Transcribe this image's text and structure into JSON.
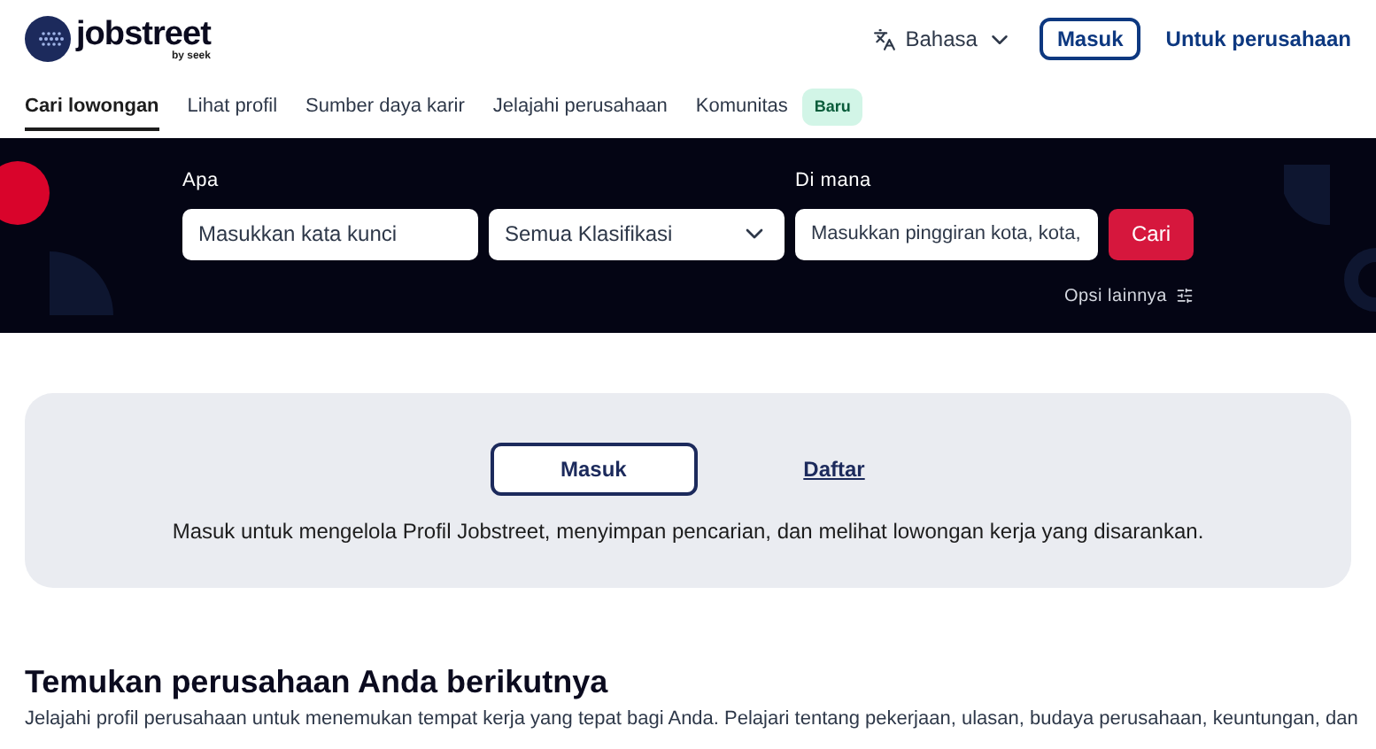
{
  "header": {
    "logo": {
      "name": "jobstreet",
      "tagline": "by seek"
    },
    "language": "Bahasa",
    "login": "Masuk",
    "employer_link": "Untuk perusahaan"
  },
  "nav": [
    {
      "label": "Cari lowongan",
      "selected": true
    },
    {
      "label": "Lihat profil",
      "selected": false
    },
    {
      "label": "Sumber daya karir",
      "selected": false
    },
    {
      "label": "Jelajahi perusahaan",
      "selected": false
    },
    {
      "label": "Komunitas",
      "selected": false,
      "badge": "Baru"
    }
  ],
  "search": {
    "what_label": "Apa",
    "what_placeholder": "Masukkan kata kunci",
    "classification": "Semua Klasifikasi",
    "where_label": "Di mana",
    "where_placeholder": "Masukkan pinggiran kota, kota,",
    "button": "Cari",
    "more_options": "Opsi lainnya"
  },
  "signin_card": {
    "login": "Masuk",
    "register": "Daftar",
    "message": "Masuk untuk mengelola Profil Jobstreet, menyimpan pencarian, dan melihat lowongan kerja yang disarankan."
  },
  "companies": {
    "title": "Temukan perusahaan Anda berikutnya",
    "description": "Jelajahi profil perusahaan untuk menemukan tempat kerja yang tepat bagi Anda. Pelajari tentang pekerjaan, ulasan, budaya perusahaan, keuntungan, dan"
  }
}
